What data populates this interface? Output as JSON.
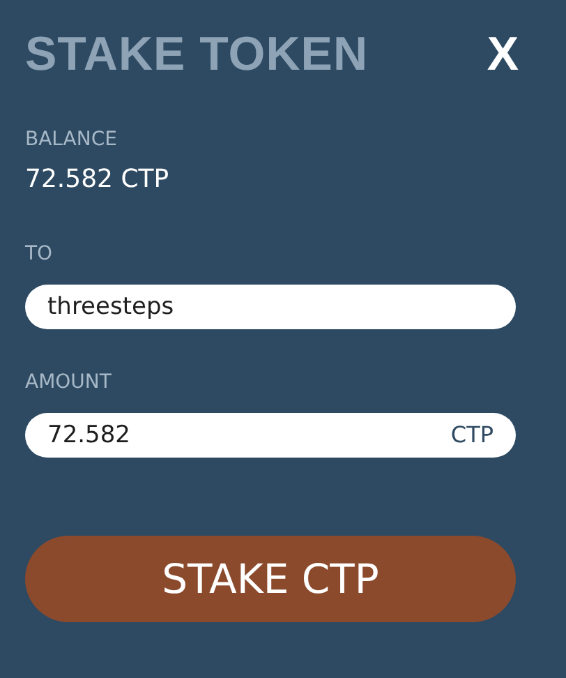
{
  "dialog": {
    "title": "STAKE TOKEN",
    "close": "X"
  },
  "balance": {
    "label": "BALANCE",
    "value": "72.582 CTP"
  },
  "to": {
    "label": "TO",
    "value": "threesteps"
  },
  "amount": {
    "label": "AMOUNT",
    "value": "72.582",
    "unit": "CTP"
  },
  "submit": {
    "label": "STAKE CTP"
  }
}
